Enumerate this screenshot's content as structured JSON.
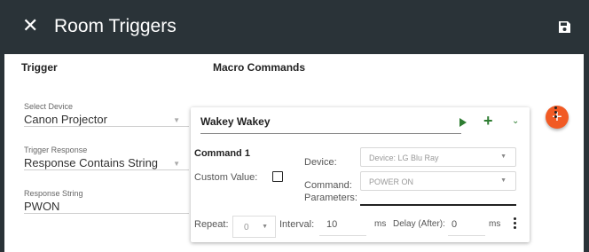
{
  "header": {
    "title": "Room Triggers",
    "close_icon": "close-icon",
    "save_icon": "floppy-disk-icon"
  },
  "columns": {
    "trigger": "Trigger",
    "macro": "Macro Commands"
  },
  "fab_symbol": "+",
  "trigger": {
    "device_label": "Select Device",
    "device_value": "Canon Projector",
    "response_label": "Trigger Response",
    "response_value": "Response Contains String",
    "string_label": "Response String",
    "string_value": "PWON"
  },
  "macro": {
    "name": "Wakey Wakey",
    "command_title": "Command 1",
    "custom_value_label": "Custom Value:",
    "device_label": "Device:",
    "device_value": "Device: LG Blu Ray",
    "command_label": "Command:",
    "parameters_label": "Parameters:",
    "command_value": "POWER ON",
    "repeat_label": "Repeat:",
    "repeat_value": "0",
    "interval_label": "Interval:",
    "interval_value": "10",
    "ms_label": "ms",
    "delay_label": "Delay (After):",
    "delay_value": "0",
    "ms_label_2": "ms"
  },
  "colors": {
    "appbar": "#2a3338",
    "accent": "#f15a24",
    "action_green": "#2e7d32"
  }
}
